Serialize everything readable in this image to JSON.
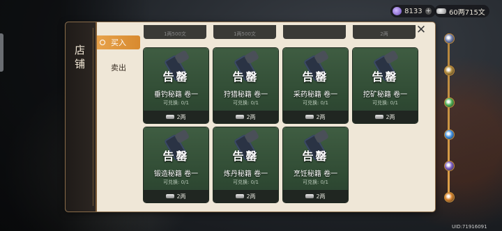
{
  "currency": {
    "jade": "8133",
    "plus": "+",
    "money": "60两715文"
  },
  "shop": {
    "title": "店铺",
    "tabs": [
      {
        "label": "买入"
      },
      {
        "label": "卖出"
      }
    ],
    "close_icon": "close-icon"
  },
  "items": [
    {
      "badge": "告罄",
      "name": "垂钓秘籍 卷一",
      "exchange": "可兑换: 0/1",
      "price": "2两"
    },
    {
      "badge": "告罄",
      "name": "狩猎秘籍 卷一",
      "exchange": "可兑换: 0/1",
      "price": "2两"
    },
    {
      "badge": "告罄",
      "name": "采药秘籍 卷一",
      "exchange": "可兑换: 0/1",
      "price": "2两"
    },
    {
      "badge": "告罄",
      "name": "挖矿秘籍 卷一",
      "exchange": "可兑换: 0/1",
      "price": "2两"
    },
    {
      "badge": "告罄",
      "name": "锻造秘籍 卷一",
      "exchange": "可兑换: 0/1",
      "price": "2两"
    },
    {
      "badge": "告罄",
      "name": "炼丹秘籍 卷一",
      "exchange": "可兑换: 0/1",
      "price": "2两"
    },
    {
      "badge": "告罄",
      "name": "烹饪秘籍 卷一",
      "exchange": "可兑换: 0/1",
      "price": "2两"
    }
  ],
  "prev_row_prices": [
    "1两500文",
    "1两500文",
    "",
    "2两"
  ],
  "uid": "UID:71916091",
  "track_node_colors": [
    "#6f7fb0",
    "#b08a3a",
    "#4caf50",
    "#3d8ee0",
    "#7b5cc4",
    "#d9822b"
  ]
}
